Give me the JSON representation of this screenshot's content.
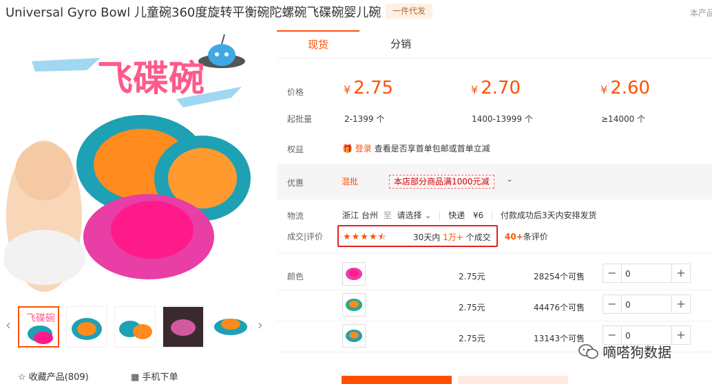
{
  "product": {
    "title": "Universal Gyro Bowl 儿童碗360度旋转平衡碗陀螺碗飞碟碗婴儿碗",
    "badge": "一件代发",
    "corner_text": "本产品"
  },
  "gallery": {
    "main_image_text": "飞碟碗",
    "thumbnails": [
      {
        "name": "thumb-1",
        "text": "飞碟碗"
      },
      {
        "name": "thumb-2",
        "text": ""
      },
      {
        "name": "thumb-3",
        "text": ""
      },
      {
        "name": "thumb-4",
        "text": ""
      },
      {
        "name": "thumb-5",
        "text": ""
      }
    ],
    "prev_arrow": "‹",
    "next_arrow": "›"
  },
  "actions": {
    "favorite_label": "收藏产品(809)",
    "mobile_order_label": "手机下单"
  },
  "tabs": [
    {
      "label": "现货"
    },
    {
      "label": "分销"
    }
  ],
  "pricing": {
    "price_label": "价格",
    "moq_label": "起批量",
    "currency": "¥",
    "tiers": [
      {
        "price": "2.75",
        "qty": "2-1399 个"
      },
      {
        "price": "2.70",
        "qty": "1400-13999 个"
      },
      {
        "price": "2.60",
        "qty": "≥14000 个"
      }
    ]
  },
  "benefits": {
    "label": "权益",
    "login": "登录",
    "text": "查看是否享首单包邮或首单立减"
  },
  "promo": {
    "label": "优惠",
    "tag": "混批",
    "coupon": "本店部分商品满1000元减",
    "chevron": "⌄"
  },
  "shipping": {
    "label": "物流",
    "origin": "浙江 台州",
    "to": "至",
    "destination": "请选择",
    "method": "快递",
    "fee": "¥6",
    "note": "付款成功后3天内安排发货"
  },
  "stats": {
    "label": "成交|评价",
    "stars": "★★★★⯪",
    "period": "30天内",
    "count": "1万+",
    "suffix": "个成交",
    "review_count": "40+",
    "review_suffix": "条评价"
  },
  "colors": {
    "label": "颜色",
    "rows": [
      {
        "price": "2.75元",
        "stock": "28254个可售",
        "qty": "0"
      },
      {
        "price": "2.75元",
        "stock": "44476个可售",
        "qty": "0"
      },
      {
        "price": "2.75元",
        "stock": "13143个可售",
        "qty": "0"
      }
    ]
  },
  "watermark": {
    "text": "嘀嗒狗数据"
  },
  "theme": {
    "accent": "#ff5000",
    "highlight_border": "#e02020"
  }
}
